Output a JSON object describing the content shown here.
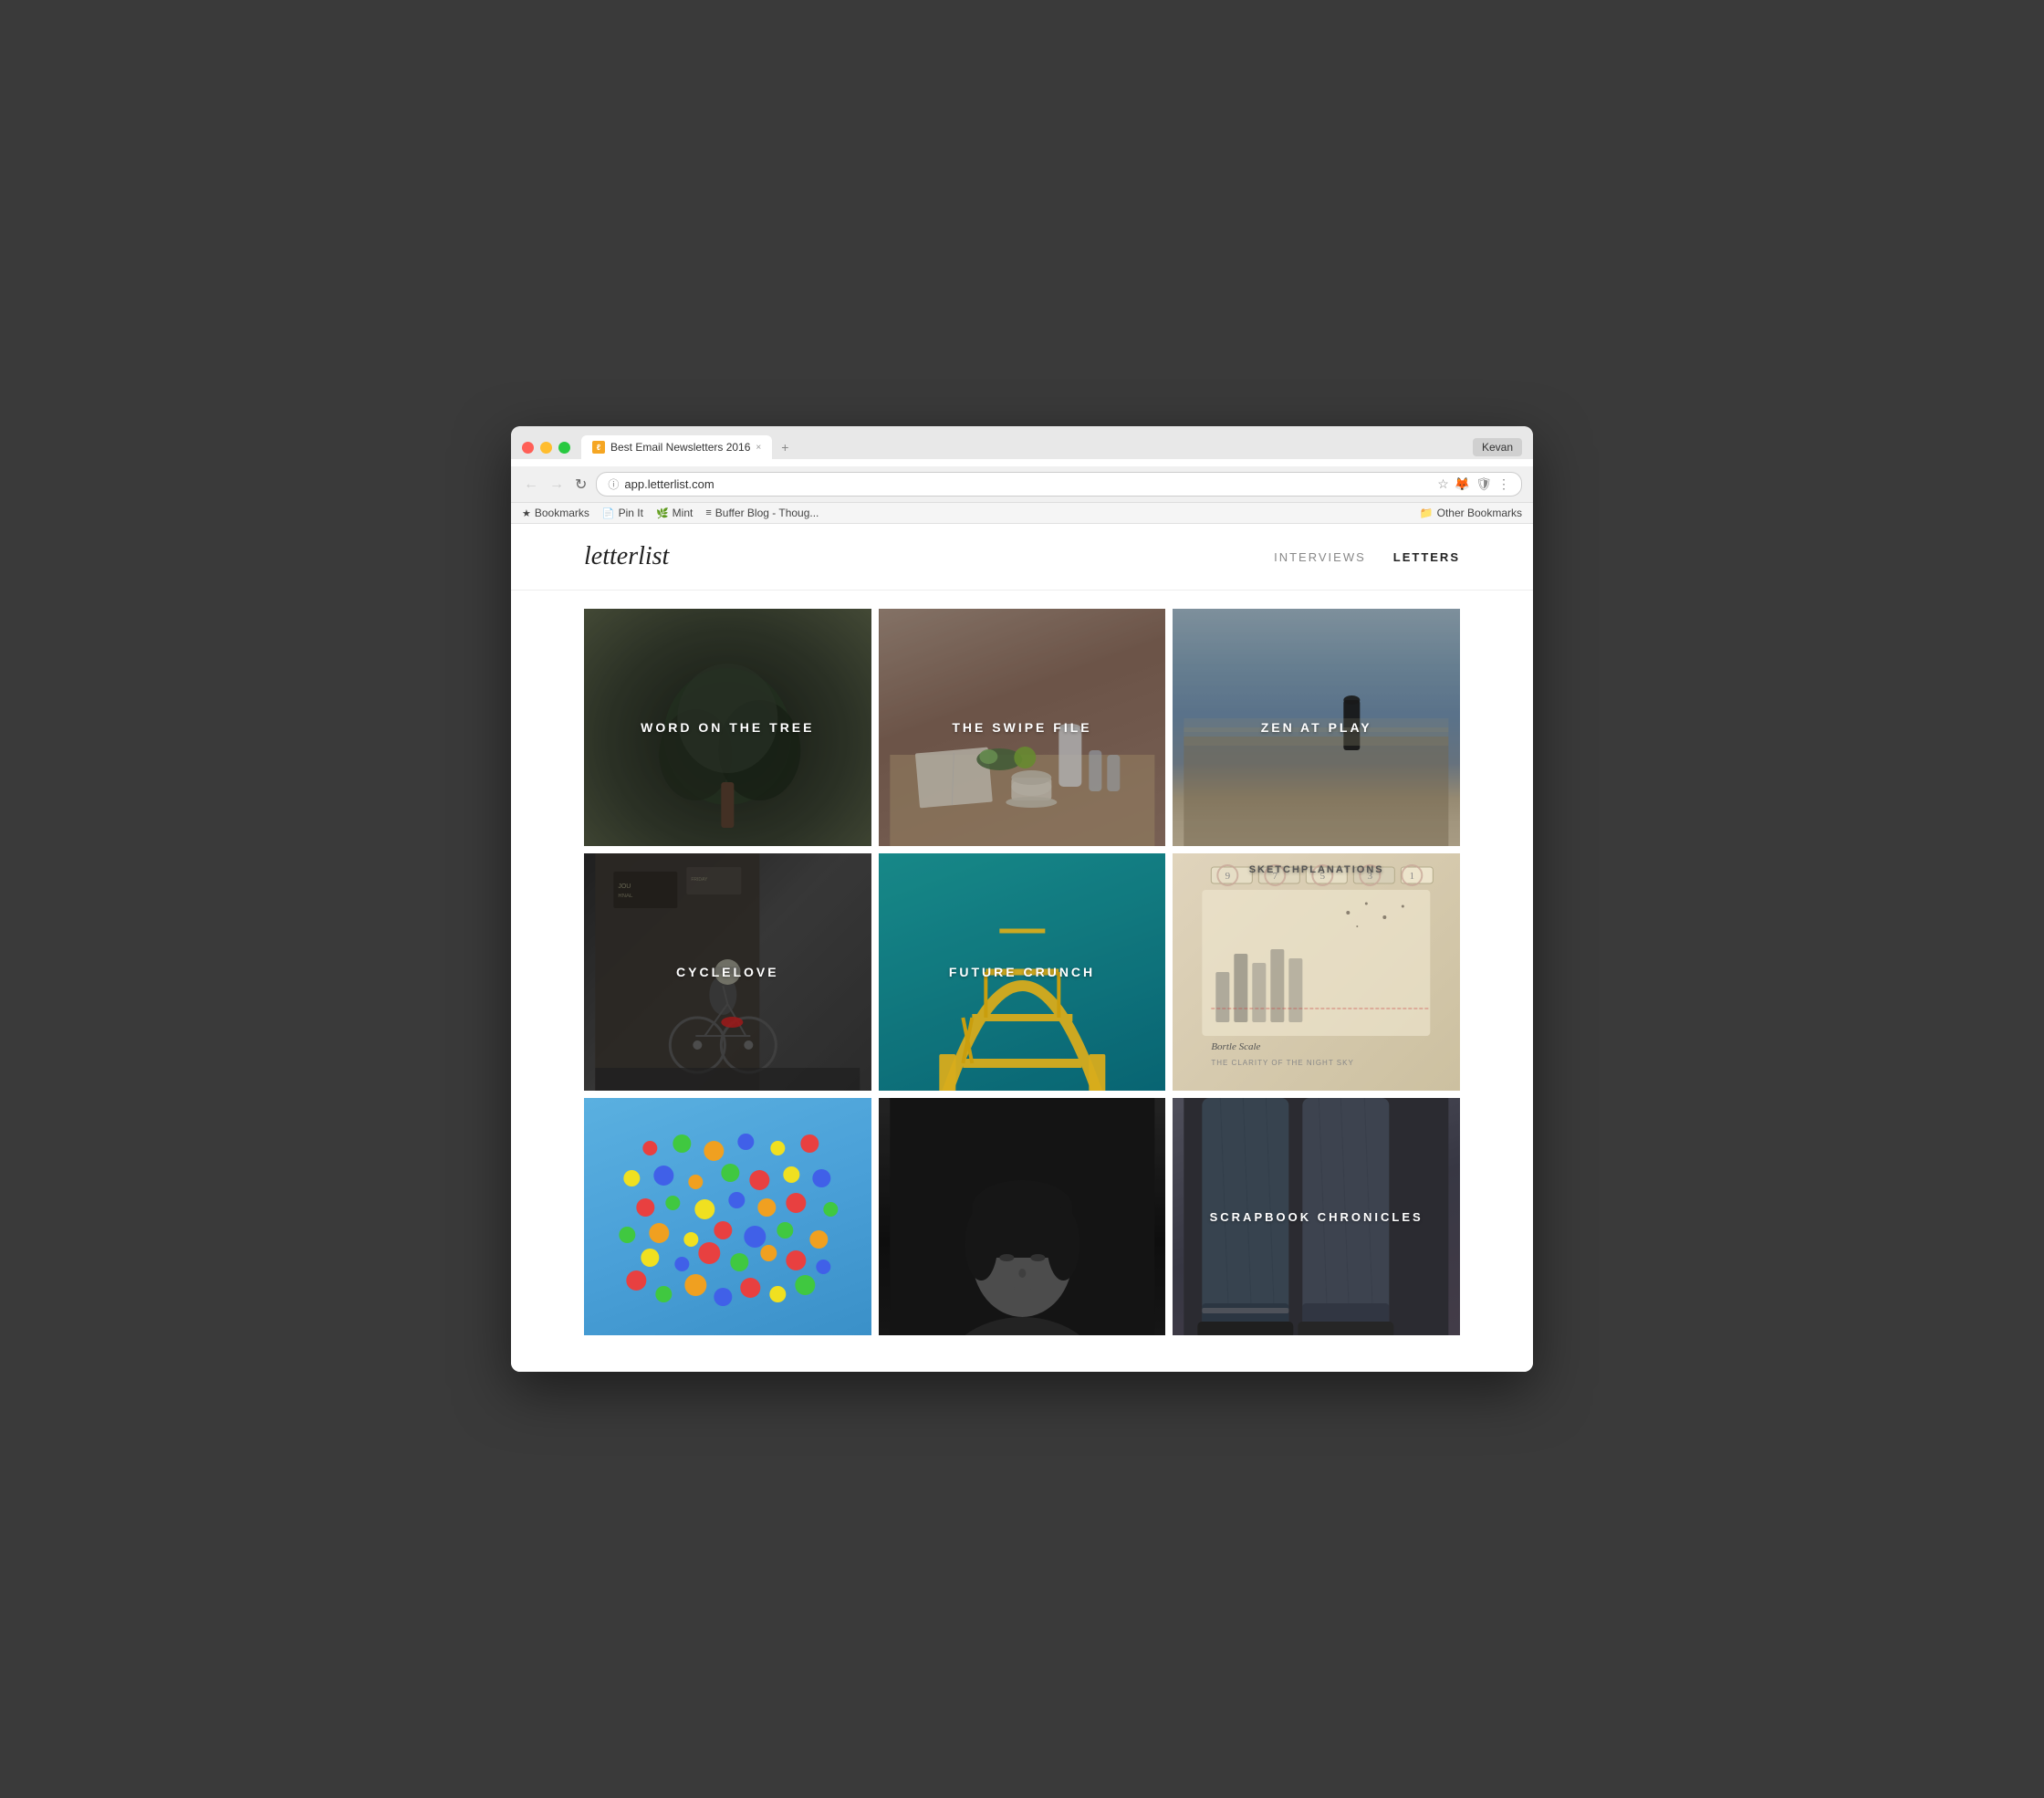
{
  "browser": {
    "tab_title": "Best Email Newsletters 2016",
    "tab_favicon_text": "ℓ",
    "tab_close": "×",
    "new_tab_label": "+",
    "user_badge": "Kevan",
    "back_btn": "←",
    "forward_btn": "→",
    "refresh_btn": "↻",
    "address": "app.letterlist.com",
    "star_icon": "★",
    "other_bookmarks_label": "Other Bookmarks",
    "bookmarks": [
      {
        "icon": "★",
        "label": "Bookmarks"
      },
      {
        "icon": "📄",
        "label": "Pin It"
      },
      {
        "icon": "🌿",
        "label": "Mint"
      },
      {
        "icon": "≡",
        "label": "Buffer Blog - Thoug..."
      }
    ]
  },
  "site": {
    "logo": "letterlist",
    "nav": [
      {
        "label": "INTERVIEWS",
        "active": false
      },
      {
        "label": "LETTERS",
        "active": true
      }
    ]
  },
  "grid": {
    "items": [
      {
        "id": "word-on-the-tree",
        "title": "WORD ON THE TREE",
        "bg_class": "bg-dark-green",
        "type": "nature"
      },
      {
        "id": "the-swipe-file",
        "title": "THE SWIPE FILE",
        "bg_class": "bg-coffee",
        "type": "coffee"
      },
      {
        "id": "zen-at-play",
        "title": "ZEN AT PLAY",
        "bg_class": "bg-ocean",
        "type": "ocean"
      },
      {
        "id": "cyclelove",
        "title": "CYCLELOVE",
        "bg_class": "bg-urban",
        "type": "urban"
      },
      {
        "id": "future-crunch",
        "title": "FUTURE CRUNCH",
        "bg_class": "bg-teal",
        "type": "teal"
      },
      {
        "id": "sketchplanations",
        "title": "SKETCHPLANATIONS",
        "bg_class": "bg-sketch",
        "type": "sketch"
      },
      {
        "id": "balloons",
        "title": "",
        "bg_class": "bg-balloons",
        "type": "balloons"
      },
      {
        "id": "portrait",
        "title": "",
        "bg_class": "bg-portrait",
        "type": "portrait"
      },
      {
        "id": "scrapbook-chronicles",
        "title": "SCRAPBOOK CHRONICLES",
        "bg_class": "bg-jeans",
        "type": "jeans"
      }
    ]
  }
}
